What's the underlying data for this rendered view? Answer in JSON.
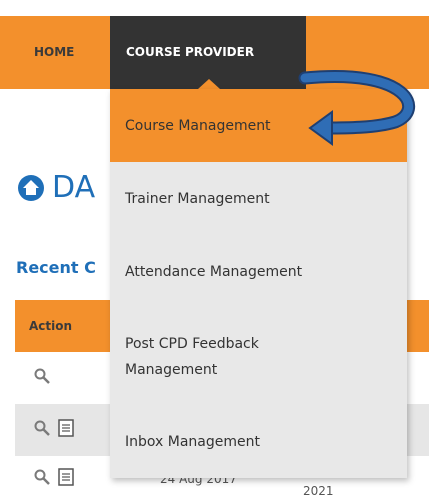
{
  "nav": {
    "home_label": "HOME",
    "course_provider_label": "COURSE PROVIDER"
  },
  "dropdown": {
    "items": [
      {
        "label": "Course Management"
      },
      {
        "label": "Trainer Management"
      },
      {
        "label": "Attendance Management"
      },
      {
        "label": "Post CPD Feedback Management"
      },
      {
        "label": "Inbox Management"
      }
    ]
  },
  "page": {
    "title_partial": "DA",
    "recent_heading_partial": "Recent C"
  },
  "table": {
    "header_action": "Action",
    "rows": [
      {
        "icons": [
          "search-icon"
        ],
        "date": "",
        "year": ""
      },
      {
        "icons": [
          "search-icon",
          "document-icon"
        ],
        "date": "",
        "year": ""
      },
      {
        "icons": [
          "search-icon",
          "document-icon"
        ],
        "date": "24 Aug 2017",
        "year": "2021"
      }
    ]
  },
  "colors": {
    "accent_orange": "#f3902c",
    "nav_dark": "#333333",
    "link_blue": "#1f6fb8",
    "annotation_arrow": "#2f6db5"
  }
}
